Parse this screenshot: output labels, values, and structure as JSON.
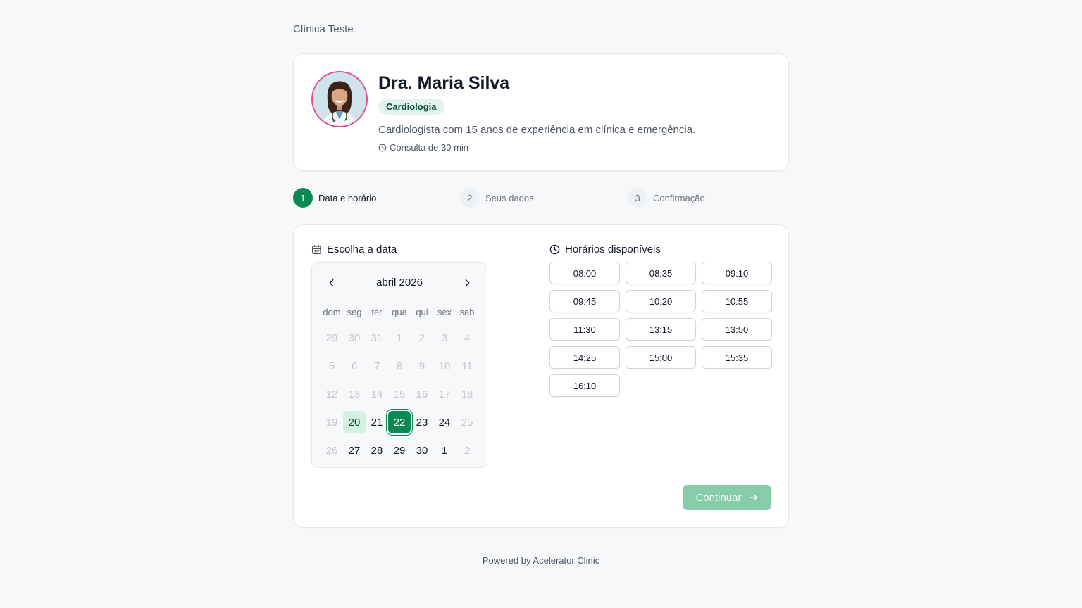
{
  "clinic": {
    "name": "Clínica Teste"
  },
  "doctor": {
    "name": "Dra. Maria Silva",
    "specialty": "Cardiologia",
    "bio": "Cardiologista com 15 anos de experiência em clínica e emergência.",
    "duration": "Consulta de 30 min"
  },
  "steps": [
    {
      "num": "1",
      "label": "Data e horário",
      "active": true
    },
    {
      "num": "2",
      "label": "Seus dados",
      "active": false
    },
    {
      "num": "3",
      "label": "Confirmação",
      "active": false
    }
  ],
  "date_section": {
    "title": "Escolha a data"
  },
  "calendar": {
    "month_label": "abril 2026",
    "weekdays": [
      "dom",
      "seg",
      "ter",
      "qua",
      "qui",
      "sex",
      "sab"
    ],
    "weeks": [
      [
        {
          "d": "29",
          "s": "muted"
        },
        {
          "d": "30",
          "s": "muted"
        },
        {
          "d": "31",
          "s": "muted"
        },
        {
          "d": "1",
          "s": "muted"
        },
        {
          "d": "2",
          "s": "muted"
        },
        {
          "d": "3",
          "s": "muted"
        },
        {
          "d": "4",
          "s": "muted"
        }
      ],
      [
        {
          "d": "5",
          "s": "muted"
        },
        {
          "d": "6",
          "s": "muted"
        },
        {
          "d": "7",
          "s": "muted"
        },
        {
          "d": "8",
          "s": "muted"
        },
        {
          "d": "9",
          "s": "muted"
        },
        {
          "d": "10",
          "s": "muted"
        },
        {
          "d": "11",
          "s": "muted"
        }
      ],
      [
        {
          "d": "12",
          "s": "muted"
        },
        {
          "d": "13",
          "s": "muted"
        },
        {
          "d": "14",
          "s": "muted"
        },
        {
          "d": "15",
          "s": "muted"
        },
        {
          "d": "16",
          "s": "muted"
        },
        {
          "d": "17",
          "s": "muted"
        },
        {
          "d": "18",
          "s": "muted"
        }
      ],
      [
        {
          "d": "19",
          "s": "muted"
        },
        {
          "d": "20",
          "s": "today"
        },
        {
          "d": "21",
          "s": "avail"
        },
        {
          "d": "22",
          "s": "selected"
        },
        {
          "d": "23",
          "s": "avail"
        },
        {
          "d": "24",
          "s": "avail"
        },
        {
          "d": "25",
          "s": "muted"
        }
      ],
      [
        {
          "d": "26",
          "s": "muted"
        },
        {
          "d": "27",
          "s": "avail"
        },
        {
          "d": "28",
          "s": "avail"
        },
        {
          "d": "29",
          "s": "avail"
        },
        {
          "d": "30",
          "s": "avail"
        },
        {
          "d": "1",
          "s": "avail"
        },
        {
          "d": "2",
          "s": "muted"
        }
      ]
    ]
  },
  "time_section": {
    "title": "Horários disponíveis"
  },
  "slots": [
    "08:00",
    "08:35",
    "09:10",
    "09:45",
    "10:20",
    "10:55",
    "11:30",
    "13:15",
    "13:50",
    "14:25",
    "15:00",
    "15:35",
    "16:10"
  ],
  "actions": {
    "continue_label": "Continuar"
  },
  "footer": {
    "text": "Powered by Acelerator Clinic"
  },
  "colors": {
    "brand": "#0a8a52",
    "brand_light": "#d6f0e2",
    "continue_disabled": "#86cca9",
    "avatar_ring": "#e04e93"
  }
}
